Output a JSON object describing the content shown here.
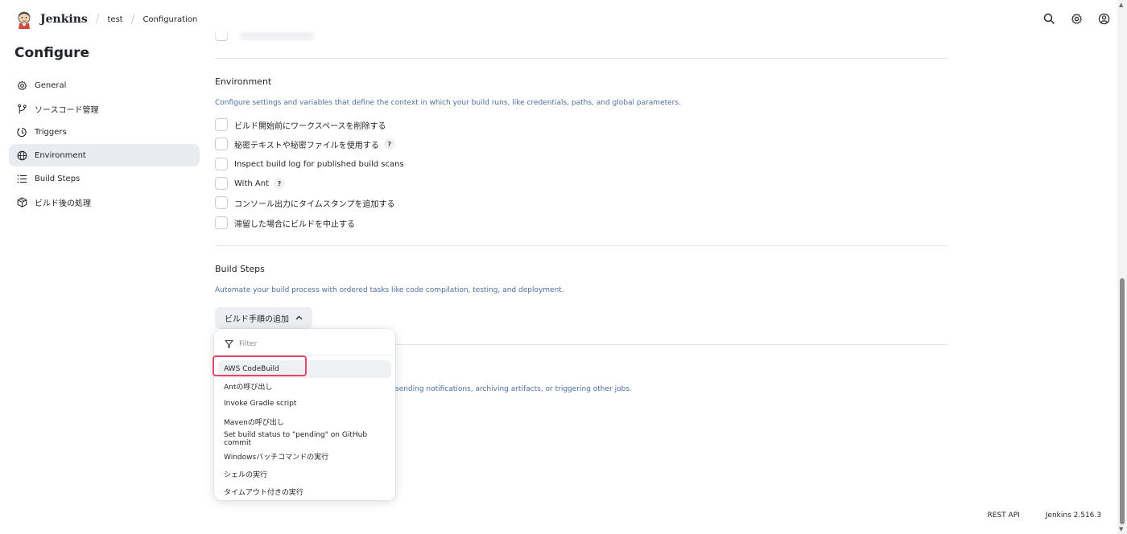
{
  "header": {
    "brand": "Jenkins",
    "breadcrumbs": [
      "test",
      "Configuration"
    ]
  },
  "sidebar": {
    "title": "Configure",
    "items": [
      {
        "label": "General",
        "icon": "gear-icon"
      },
      {
        "label": "ソースコード管理",
        "icon": "branch-icon"
      },
      {
        "label": "Triggers",
        "icon": "clock-icon"
      },
      {
        "label": "Environment",
        "icon": "globe-icon",
        "active": true
      },
      {
        "label": "Build Steps",
        "icon": "list-icon"
      },
      {
        "label": "ビルド後の処理",
        "icon": "package-icon"
      }
    ]
  },
  "environment": {
    "title": "Environment",
    "description": "Configure settings and variables that define the context in which your build runs, like credentials, paths, and global parameters.",
    "options": [
      {
        "label": "ビルド開始前にワークスペースを削除する",
        "help": false
      },
      {
        "label": "秘密テキストや秘密ファイルを使用する",
        "help": true
      },
      {
        "label": "Inspect build log for published build scans",
        "help": false
      },
      {
        "label": "With Ant",
        "help": true
      },
      {
        "label": "コンソール出力にタイムスタンプを追加する",
        "help": false
      },
      {
        "label": "滞留した場合にビルドを中止する",
        "help": false
      }
    ]
  },
  "build_steps": {
    "title": "Build Steps",
    "description": "Automate your build process with ordered tasks like code compilation, testing, and deployment.",
    "add_button": "ビルド手順の追加"
  },
  "dropdown": {
    "filter_placeholder": "Filter",
    "items": [
      "AWS CodeBuild",
      "Antの呼び出し",
      "Invoke Gradle script",
      "Mavenの呼び出し",
      "Set build status to \"pending\" on GitHub commit",
      "Windowsバッチコマンドの実行",
      "シェルの実行",
      "タイムアウト付きの実行"
    ]
  },
  "post_build": {
    "description_tail": "sending notifications, archiving artifacts, or triggering other jobs."
  },
  "help_glyph": "?",
  "footer": {
    "rest_api": "REST API",
    "version": "Jenkins 2.516.3"
  },
  "colors": {
    "accent_link": "#4a6fa5",
    "highlight": "#e8456b",
    "active_bg": "#e8ebf0"
  }
}
